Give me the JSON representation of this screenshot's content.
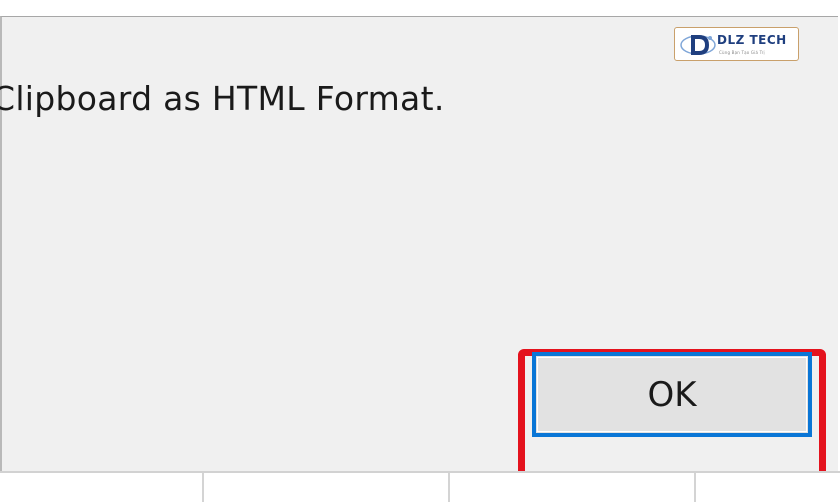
{
  "dialog": {
    "message": "Clipboard as HTML Format.",
    "ok_label": "OK"
  },
  "logo": {
    "text": "DLZ TECH",
    "tagline": "Cùng Bạn Tạo Giá Trị",
    "icon": "dlz-tech-logo-icon"
  },
  "colors": {
    "dialog_background": "#f0f0f0",
    "button_border": "#0a76d6",
    "highlight": "#e4121d",
    "logo_text": "#1f3f7f"
  }
}
